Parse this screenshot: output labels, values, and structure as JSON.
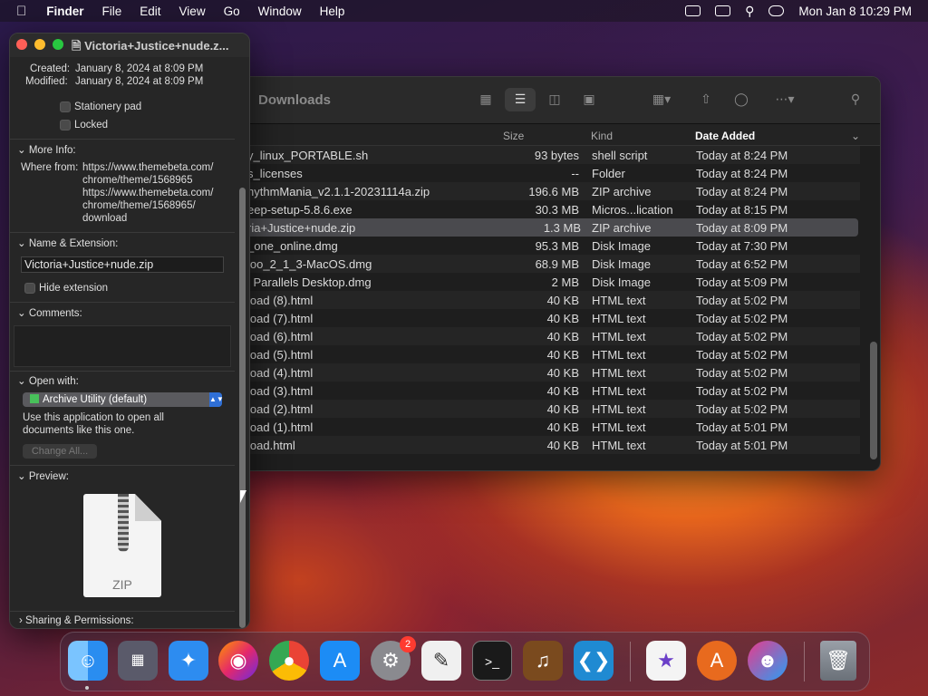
{
  "menubar": {
    "apple": "",
    "app": "Finder",
    "menus": [
      "File",
      "Edit",
      "View",
      "Go",
      "Window",
      "Help"
    ],
    "clock": "Mon Jan 8  10:29 PM"
  },
  "finder": {
    "title": "Downloads",
    "columns": {
      "size": "Size",
      "kind": "Kind",
      "date": "Date Added"
    },
    "rows": [
      {
        "name": "y_linux_PORTABLE.sh",
        "size": "93 bytes",
        "kind": "shell script",
        "date": "Today at 8:24 PM"
      },
      {
        "name": "s_licenses",
        "size": "--",
        "kind": "Folder",
        "date": "Today at 8:24 PM"
      },
      {
        "name": "hythmMania_v2.1.1-20231114a.zip",
        "size": "196.6 MB",
        "kind": "ZIP archive",
        "date": "Today at 8:24 PM"
      },
      {
        "name": "eep-setup-5.8.6.exe",
        "size": "30.3 MB",
        "kind": "Micros...lication",
        "date": "Today at 8:15 PM"
      },
      {
        "name": "ria+Justice+nude.zip",
        "size": "1.3 MB",
        "kind": "ZIP archive",
        "date": "Today at 8:09 PM"
      },
      {
        "name": "_one_online.dmg",
        "size": "95.3 MB",
        "kind": "Disk Image",
        "date": "Today at 7:30 PM"
      },
      {
        "name": "loo_2_1_3-MacOS.dmg",
        "size": "68.9 MB",
        "kind": "Disk Image",
        "date": "Today at 6:52 PM"
      },
      {
        "name": "l Parallels Desktop.dmg",
        "size": "2 MB",
        "kind": "Disk Image",
        "date": "Today at 5:09 PM"
      },
      {
        "name": "load (8).html",
        "size": "40 KB",
        "kind": "HTML text",
        "date": "Today at 5:02 PM"
      },
      {
        "name": "load (7).html",
        "size": "40 KB",
        "kind": "HTML text",
        "date": "Today at 5:02 PM"
      },
      {
        "name": "load (6).html",
        "size": "40 KB",
        "kind": "HTML text",
        "date": "Today at 5:02 PM"
      },
      {
        "name": "load (5).html",
        "size": "40 KB",
        "kind": "HTML text",
        "date": "Today at 5:02 PM"
      },
      {
        "name": "load (4).html",
        "size": "40 KB",
        "kind": "HTML text",
        "date": "Today at 5:02 PM"
      },
      {
        "name": "load (3).html",
        "size": "40 KB",
        "kind": "HTML text",
        "date": "Today at 5:02 PM"
      },
      {
        "name": "load (2).html",
        "size": "40 KB",
        "kind": "HTML text",
        "date": "Today at 5:02 PM"
      },
      {
        "name": "load (1).html",
        "size": "40 KB",
        "kind": "HTML text",
        "date": "Today at 5:01 PM"
      },
      {
        "name": "load.html",
        "size": "40 KB",
        "kind": "HTML text",
        "date": "Today at 5:01 PM"
      }
    ]
  },
  "info": {
    "title": "Victoria+Justice+nude.z...",
    "created_label": "Created:",
    "created": "January 8, 2024 at 8:09 PM",
    "modified_label": "Modified:",
    "modified": "January 8, 2024 at 8:09 PM",
    "stationery": "Stationery pad",
    "locked": "Locked",
    "more_info": "More Info:",
    "where_from_label": "Where from:",
    "where_from": [
      "https://www.themebeta.com/",
      "chrome/theme/1568965",
      "https://www.themebeta.com/",
      "chrome/theme/1568965/",
      "download"
    ],
    "name_ext": "Name & Extension:",
    "filename": "Victoria+Justice+nude.zip",
    "hide_ext": "Hide extension",
    "comments": "Comments:",
    "open_with": "Open with:",
    "app": "Archive Utility (default)",
    "use_app": [
      "Use this application to open all",
      "documents like this one."
    ],
    "change_all": "Change All...",
    "preview": "Preview:",
    "zip_label": "ZIP",
    "sharing": "Sharing & Permissions:"
  },
  "dock": {
    "badge": "2"
  }
}
